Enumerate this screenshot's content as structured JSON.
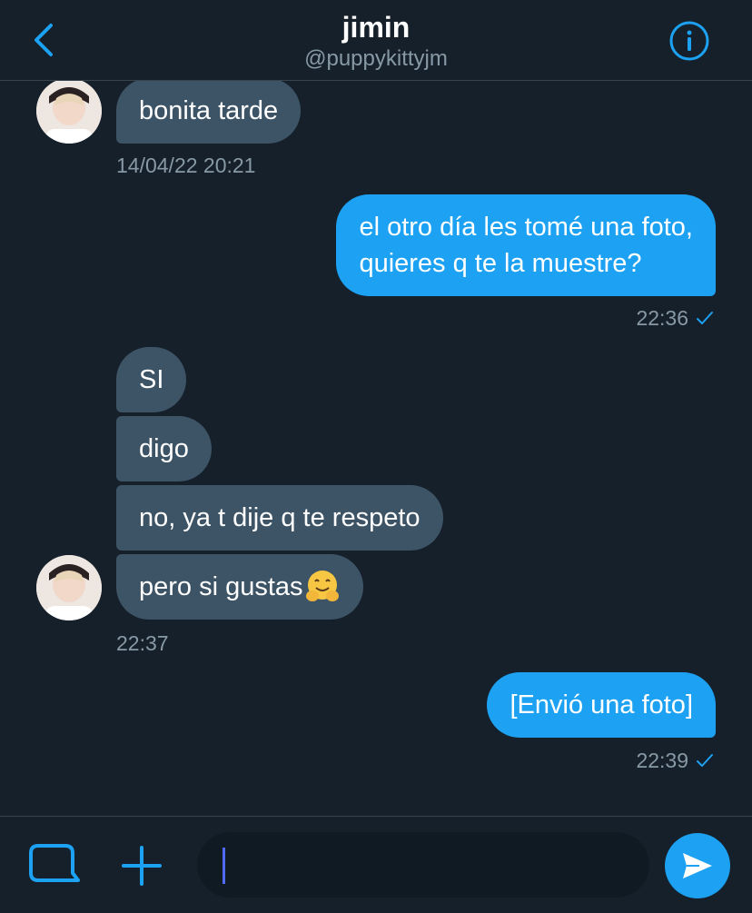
{
  "header": {
    "title": "jimin",
    "handle": "@puppykittyjm"
  },
  "messages": [
    {
      "direction": "incoming",
      "text": "bonita tarde"
    },
    {
      "direction": "incoming_timestamp",
      "text": "14/04/22 20:21"
    },
    {
      "direction": "outgoing",
      "lines": [
        "el otro día les tomé una foto,",
        "quieres q te la muestre?"
      ]
    },
    {
      "direction": "outgoing_timestamp",
      "text": "22:36"
    },
    {
      "direction": "incoming",
      "text": "SI"
    },
    {
      "direction": "incoming",
      "text": "digo"
    },
    {
      "direction": "incoming",
      "text": "no, ya t dije q te respeto"
    },
    {
      "direction": "incoming",
      "text": "pero si gustas"
    },
    {
      "direction": "incoming_timestamp",
      "text": "22:37"
    },
    {
      "direction": "outgoing",
      "text": "[Envió una foto]"
    },
    {
      "direction": "outgoing_timestamp",
      "text": "22:39"
    }
  ],
  "composer": {
    "value": "",
    "placeholder": ""
  },
  "icons": {
    "back": "chevron-left-icon",
    "info": "info-icon",
    "gif": "gif-icon",
    "add": "plus-icon",
    "send": "send-icon",
    "read": "check-icon",
    "emoji": "hugging-face-icon"
  },
  "colors": {
    "background": "#15202b",
    "accent": "#1da1f2",
    "incoming_bubble": "#3d5466",
    "muted_text": "#8899a6"
  }
}
